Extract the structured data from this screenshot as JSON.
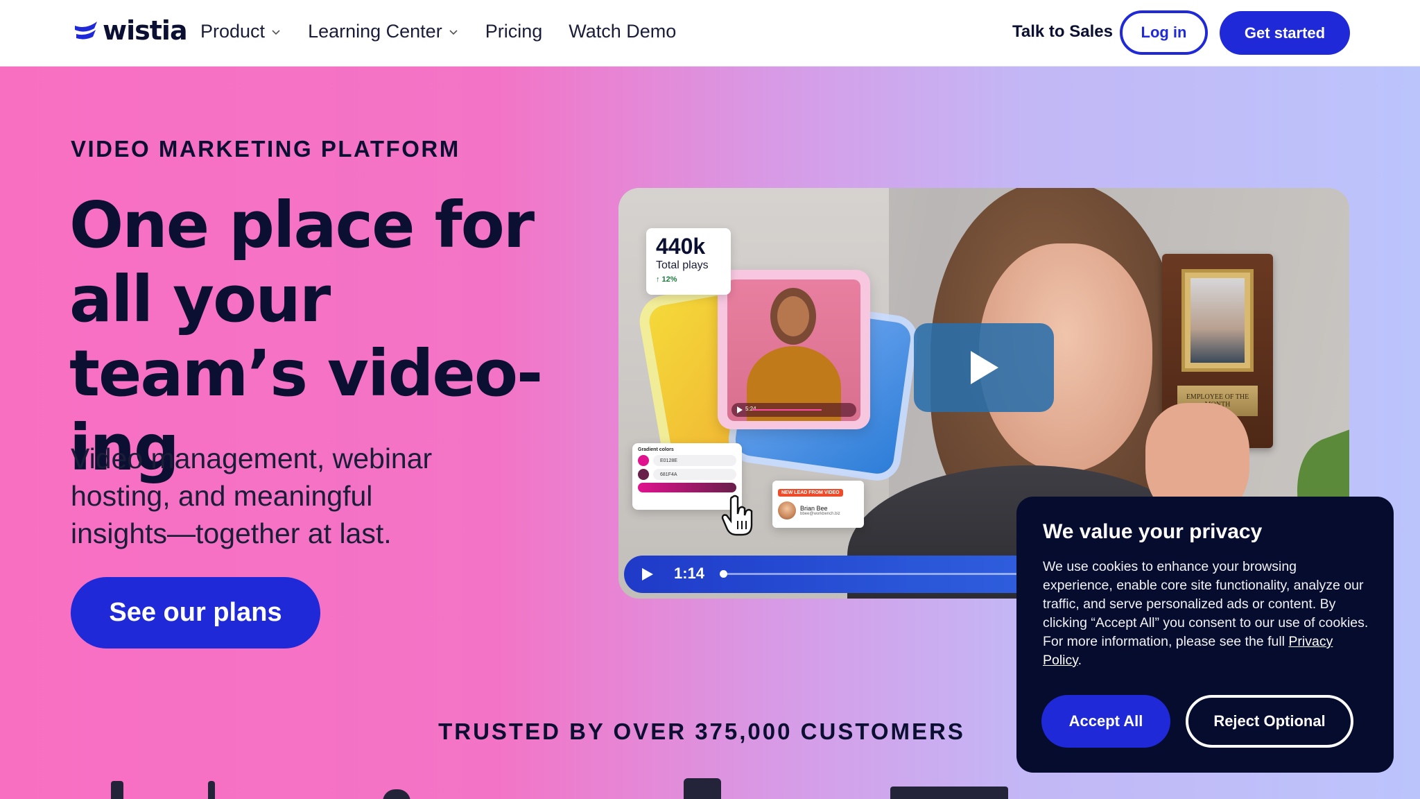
{
  "header": {
    "logo_text": "wistia",
    "nav": [
      {
        "label": "Product",
        "has_dropdown": true
      },
      {
        "label": "Learning Center",
        "has_dropdown": true
      },
      {
        "label": "Pricing",
        "has_dropdown": false
      },
      {
        "label": "Watch Demo",
        "has_dropdown": false
      }
    ],
    "talk_to_sales": "Talk to Sales",
    "login": "Log in",
    "get_started": "Get started"
  },
  "hero": {
    "eyebrow": "VIDEO MARKETING PLATFORM",
    "headline": "One place for all your team’s video-ing",
    "subhead": "Video management, webinar hosting, and meaningful insights—together at last.",
    "cta": "See our plans",
    "trusted": "TRUSTED BY OVER 375,000 CUSTOMERS"
  },
  "video": {
    "stat_value": "440k",
    "stat_label": "Total plays",
    "stat_delta": "↑ 12%",
    "gradient_title": "Gradient colors",
    "gradient_colors": [
      {
        "label": "E0128E",
        "color": "#E0128E"
      },
      {
        "label": "681F4A",
        "color": "#681F4A"
      }
    ],
    "lead_tag": "NEW LEAD FROM VIDEO",
    "lead_name": "Brian Bee",
    "lead_email": "bbee@workbench.biz",
    "mini_time": "5:24",
    "plaque_text": "EMPLOYEE OF THE MONTH",
    "time": "1:14"
  },
  "cookie": {
    "title": "We value your privacy",
    "body": "We use cookies to enhance your browsing experience, enable core site functionality, analyze our traffic, and serve personalized ads or content. By clicking “Accept All” you consent to our use of cookies. For more information, please see the full ",
    "link": "Privacy Policy",
    "period": ".",
    "accept": "Accept All",
    "reject": "Reject Optional"
  },
  "colors": {
    "brand_blue": "#1F29D8",
    "navy": "#0B1033",
    "pink": "#F86FC2",
    "lavender": "#BCC4FC"
  }
}
